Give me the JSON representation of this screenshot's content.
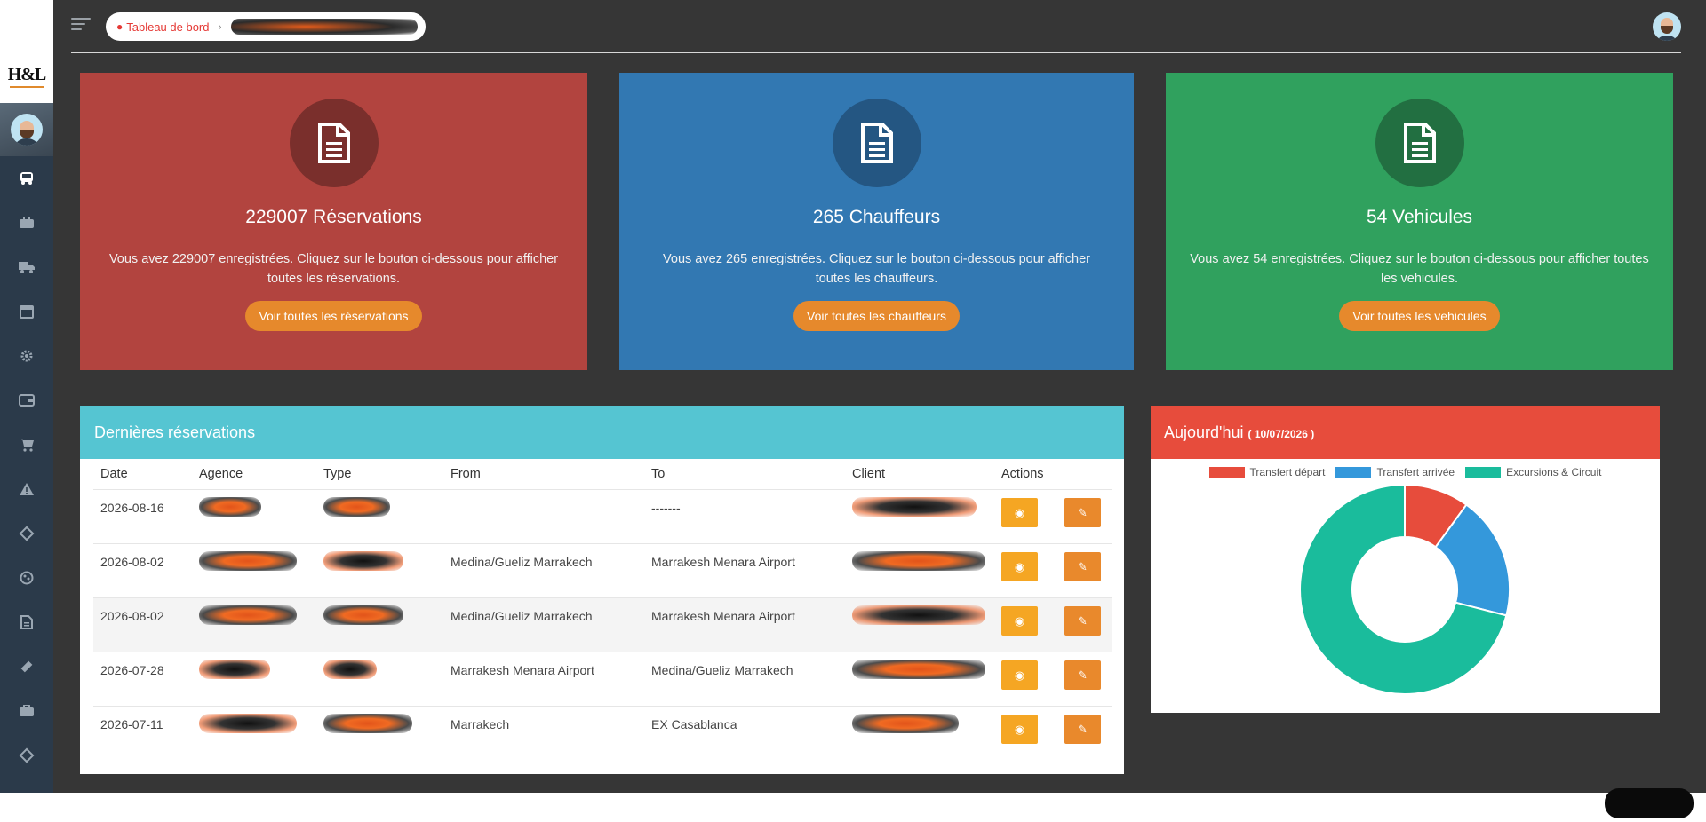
{
  "breadcrumb": {
    "label": "Tableau de bord"
  },
  "cards": [
    {
      "title": "229007 Réservations",
      "desc": "Vous avez 229007 enregistrées. Cliquez sur le bouton ci-dessous pour afficher toutes les réservations.",
      "button": "Voir toutes les réservations",
      "color": "#b2443f"
    },
    {
      "title": "265 Chauffeurs",
      "desc": "Vous avez 265 enregistrées. Cliquez sur le bouton ci-dessous pour afficher toutes les chauffeurs.",
      "button": "Voir toutes les chauffeurs",
      "color": "#3278b2"
    },
    {
      "title": "54 Vehicules",
      "desc": "Vous avez 54 enregistrées. Cliquez sur le bouton ci-dessous pour afficher toutes les vehicules.",
      "button": "Voir toutes les vehicules",
      "color": "#30a15e"
    }
  ],
  "table": {
    "title": "Dernières réservations",
    "columns": [
      "Date",
      "Agence",
      "Type",
      "From",
      "To",
      "Client",
      "Actions"
    ],
    "rows": [
      {
        "date": "2026-08-16",
        "from": "",
        "to": "-------"
      },
      {
        "date": "2026-08-02",
        "from": "Medina/Gueliz Marrakech",
        "to": "Marrakesh Menara Airport"
      },
      {
        "date": "2026-08-02",
        "from": "Medina/Gueliz Marrakech",
        "to": "Marrakesh Menara Airport"
      },
      {
        "date": "2026-07-28",
        "from": "Marrakesh Menara Airport",
        "to": "Medina/Gueliz Marrakech"
      },
      {
        "date": "2026-07-11",
        "from": "Marrakech",
        "to": "EX Casablanca"
      }
    ]
  },
  "chart_panel": {
    "title": "Aujourd'hui",
    "date": "( 10/07/2026 )"
  },
  "chart_data": {
    "type": "pie",
    "donut": true,
    "categories": [
      "Transfert départ",
      "Transfert arrivée",
      "Excursions & Circuit"
    ],
    "values": [
      10,
      19,
      71
    ],
    "colors": [
      "#e74c3c",
      "#3498db",
      "#1abc9c"
    ],
    "legend": "top"
  },
  "icons": {
    "sidebar": [
      "bus-icon",
      "briefcase-icon",
      "truck-icon",
      "calendar-icon",
      "gear-icon",
      "wallet-icon",
      "cart-icon",
      "warning-icon",
      "ticket-icon",
      "palette-icon",
      "document-icon",
      "tag-icon",
      "box-icon",
      "coupon-icon"
    ]
  }
}
